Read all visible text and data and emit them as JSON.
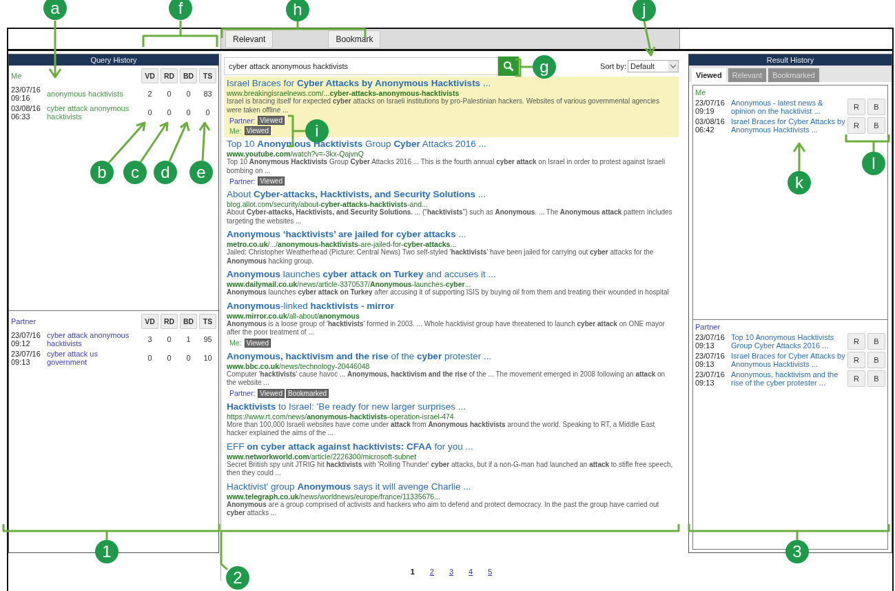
{
  "toolbar": {
    "buttons": [
      "Relevant",
      "Bookmark"
    ]
  },
  "query_history": {
    "title": "Query History",
    "sections": [
      {
        "kind": "me",
        "label": "Me",
        "columns": [
          "VD",
          "RD",
          "BD",
          "TS"
        ],
        "rows": [
          {
            "date": "23/07/16",
            "time": "09:16",
            "query": "anonymous hacktivists",
            "values": [
              "2",
              "0",
              "0",
              "83"
            ]
          },
          {
            "date": "03/08/16",
            "time": "06:33",
            "query": "cyber attack anonymous hacktivists",
            "values": [
              "0",
              "0",
              "0",
              "0"
            ]
          }
        ]
      },
      {
        "kind": "partner",
        "label": "Partner",
        "columns": [
          "VD",
          "RD",
          "BD",
          "TS"
        ],
        "rows": [
          {
            "date": "23/07/16",
            "time": "09:12",
            "query": "cyber attack anonymous hacktivists",
            "values": [
              "3",
              "0",
              "1",
              "95"
            ]
          },
          {
            "date": "23/07/16",
            "time": "09:13",
            "query": "cyber attack us government",
            "values": [
              "0",
              "0",
              "0",
              "10"
            ]
          }
        ]
      }
    ]
  },
  "search": {
    "value": "cyber attack anonymous hacktivists",
    "sort_label": "Sort by:",
    "sort_value": "Default"
  },
  "results": [
    {
      "title": "Israel Braces for **Cyber Attacks by Anonymous Hacktivists** ...",
      "url": "www.breakingisraelnews.com/...**cyber-attacks-anonymous-hacktivists**",
      "snippet": "Israel is bracing itself for expected **cyber** attacks on Israeli institutions by pro-Palestinian hackers. Websites of various governmental agencies were taken offline ...",
      "highlighted": true,
      "tags": [
        {
          "kind": "partner",
          "label": "Partner:",
          "badges": [
            "Viewed"
          ]
        },
        {
          "kind": "me",
          "label": "Me:",
          "badges": [
            "Viewed"
          ]
        }
      ]
    },
    {
      "title": "Top 10 **Anonymous Hacktivists** Group **Cyber** Attacks 2016 ...",
      "url": "**www.youtube.com**/watch?v=-3kx-QajvnQ",
      "snippet": "Top 10 **Anonymous Hacktivists** Group **Cyber** Attacks 2016 ... This is the fourth annual **cyber attack** on Israel in order to protest against Israeli bombing on ...",
      "highlighted": false,
      "tags": [
        {
          "kind": "partner",
          "label": "Partner:",
          "badges": [
            "Viewed"
          ]
        }
      ]
    },
    {
      "title": "About **Cyber-attacks, Hacktivists, and Security Solutions** ...",
      "url": "blog.allot.com/security/about-**cyber-attacks-hacktivists**-and...",
      "snippet": "About **Cyber-attacks, Hacktivists, and Security Solutions**. ... (\"**hacktivists**\") such as **Anonymous**. ... The **Anonymous attack** pattern includes targeting the websites ...",
      "highlighted": false
    },
    {
      "title": "**Anonymous ‘hacktivists’ are jailed for cyber attacks** ...",
      "url": "**metro.co.uk**/.../**anonymous-hacktivists**-are-jailed-for-**cyber-attacks**...",
      "snippet": "Jailed: Christopher Weatherhead (Picture: Central News) Two self-styled '**hacktivists**' have been jailed for carrying out **cyber** attacks for the **Anonymous** hacking group.",
      "highlighted": false
    },
    {
      "title": "**Anonymous** launches **cyber attack on Turkey** and accuses it ...",
      "url": "**www.dailymail.co.uk**/news/article-3370537/**Anonymous**-launches-**cyber**...",
      "snippet": "**Anonymous** launches **cyber attack on Turkey** after accusing it of supporting ISIS by buying oil from them and treating their wounded in hospital",
      "highlighted": false
    },
    {
      "title": "**Anonymous**-linked **hacktivists - mirror**",
      "url": "**www.mirror.co.uk**/all-about/**anonymous**",
      "snippet": "**Anonymous** is a loose group of '**hacktivists**' formed in 2003. ... Whole hacktivist group have threatened to launch **cyber attack** on ONE mayor after the poor treatment of ...",
      "highlighted": false,
      "tags": [
        {
          "kind": "me",
          "label": "Me:",
          "badges": [
            "Viewed"
          ]
        }
      ]
    },
    {
      "title": "**Anonymous, hacktivism and the rise** of the **cyber** protester ...",
      "url": "**www.bbc.co.uk**/news/technology-20446048",
      "snippet": "Computer '**hacktivists**' cause havoc ... **Anonymous, hacktivism and the rise** of the ... The movement emerged in 2008 following an **attack** on the website ...",
      "highlighted": false,
      "tags": [
        {
          "kind": "partner",
          "label": "Partner:",
          "badges": [
            "Viewed",
            "Bookmarked"
          ]
        }
      ]
    },
    {
      "title": "**Hacktivists** to Israel: 'Be ready for new larger surprises ...",
      "url": "https://www.rt.com/news/**anonymous-hacktivists**-operation-israel-474",
      "snippet": "More than 100,000 Israeli websites have come under **attack** from **Anonymous hacktivists** around the world. Speaking to RT, a Middle East hacker explained the aims of the ...",
      "highlighted": false
    },
    {
      "title": "EFF **on cyber attack against hacktivists: CFAA** for you ...",
      "url": "**www.networkworld.com**/article/2226300/microsoft-subnet",
      "snippet": "Secret British spy unit JTRIG hit **hacktivists** with 'Rolling Thunder' **cyber** attacks, but if a non-G-man had launched an **attack** to stifle free speech, then they could ...",
      "highlighted": false
    },
    {
      "title": "Hacktivist' group **Anonymous** says it will avenge Charlie ...",
      "url": "**www.telegraph.co.uk**/news/worldnews/europe/france/11335676...",
      "snippet": "**Anonymous** are a group comprised of activists and hackers who aim to defend and protect democracy. In the past the group have carried out **cyber** attacks ...",
      "highlighted": false
    }
  ],
  "pagination": [
    {
      "label": "1",
      "selected": true
    },
    {
      "label": "2",
      "selected": false
    },
    {
      "label": "3",
      "selected": false
    },
    {
      "label": "4",
      "selected": false
    },
    {
      "label": "5",
      "selected": false
    }
  ],
  "result_history": {
    "title": "Result History",
    "tabs": [
      {
        "label": "Viewed",
        "selected": true
      },
      {
        "label": "Relevant",
        "selected": false
      },
      {
        "label": "Bookmarked",
        "selected": false
      }
    ],
    "sections": [
      {
        "kind": "me",
        "label": "Me",
        "rows": [
          {
            "date": "23/07/16",
            "time": "09:19",
            "title": "Anonymous - latest news & opinion on the hacktivist ...",
            "buttons": [
              "R",
              "B"
            ]
          },
          {
            "date": "03/08/16",
            "time": "06:42",
            "title": "Israel Braces for Cyber Attacks by Anonymous Hacktivists ...",
            "buttons": [
              "R",
              "B"
            ]
          }
        ]
      },
      {
        "kind": "partner",
        "label": "Partner",
        "rows": [
          {
            "date": "23/07/16",
            "time": "09:13",
            "title": "Top 10 Anonymous Hacktivists Group Cyber Attacks 2016 ...",
            "buttons": [
              "R",
              "B"
            ]
          },
          {
            "date": "23/07/16",
            "time": "09:13",
            "title": "Israel Braces for Cyber Attacks by Anonymous Hacktivists ...",
            "buttons": [
              "R",
              "B"
            ]
          },
          {
            "date": "23/07/16",
            "time": "09:13",
            "title": "Anonymous, hacktivism and the rise of the cyber protester ...",
            "buttons": [
              "R",
              "B"
            ]
          }
        ]
      }
    ]
  },
  "callouts": [
    {
      "label": "a"
    },
    {
      "label": "f"
    },
    {
      "label": "h"
    },
    {
      "label": "j"
    },
    {
      "label": "g"
    },
    {
      "label": "i"
    },
    {
      "label": "b"
    },
    {
      "label": "c"
    },
    {
      "label": "d"
    },
    {
      "label": "e"
    },
    {
      "label": "k"
    },
    {
      "label": "l"
    },
    {
      "label": "1"
    },
    {
      "label": "2"
    },
    {
      "label": "3"
    }
  ]
}
